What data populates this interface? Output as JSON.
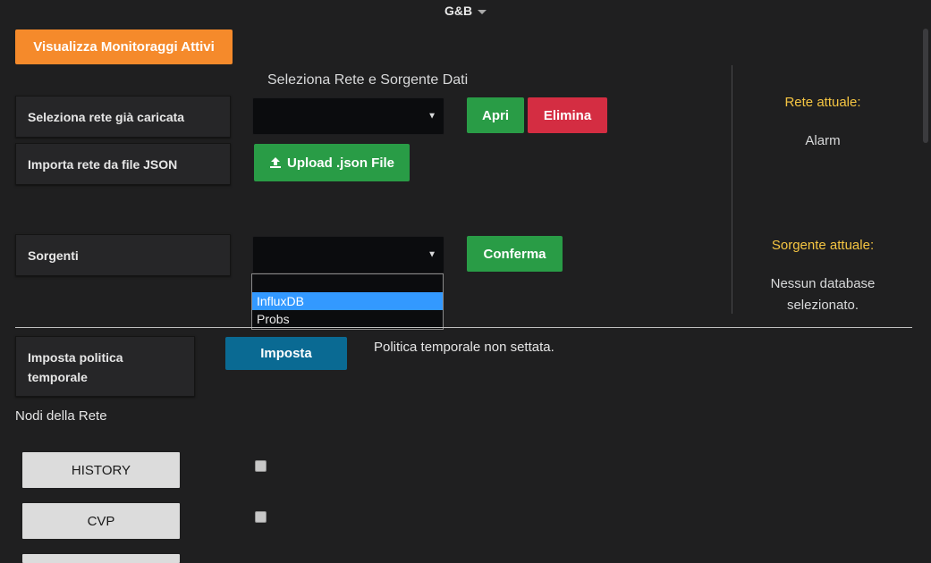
{
  "header": {
    "title": "G&B"
  },
  "toolbar": {
    "monitor_button": "Visualizza Monitoraggi Attivi"
  },
  "network": {
    "section_title": "Seleziona Rete e Sorgente Dati",
    "select_loaded_label": "Seleziona rete già caricata",
    "open_button": "Apri",
    "delete_button": "Elimina",
    "import_label": "Importa rete da file JSON",
    "upload_button": "Upload .json File"
  },
  "sources": {
    "label": "Sorgenti",
    "confirm_button": "Conferma",
    "options": [
      "",
      "InfluxDB",
      "Probs"
    ],
    "highlighted_option": "InfluxDB"
  },
  "status": {
    "current_network_heading": "Rete attuale:",
    "current_network_value": "Alarm",
    "current_source_heading": "Sorgente attuale:",
    "current_source_value_line1": "Nessun database",
    "current_source_value_line2": "selezionato."
  },
  "policy": {
    "label_line1": "Imposta politica",
    "label_line2": "temporale",
    "set_button": "Imposta",
    "status_text": "Politica temporale non settata."
  },
  "nodes": {
    "title": "Nodi della Rete",
    "items": [
      {
        "name": "HISTORY"
      },
      {
        "name": "CVP"
      }
    ]
  },
  "colors": {
    "background": "#1f1f20",
    "accent_orange": "#f58a2b",
    "success_green": "#299c46",
    "danger_red": "#d42d42",
    "primary_blue": "#0a6a93",
    "heading_yellow": "#f5c542",
    "highlight_blue": "#3399ff"
  }
}
